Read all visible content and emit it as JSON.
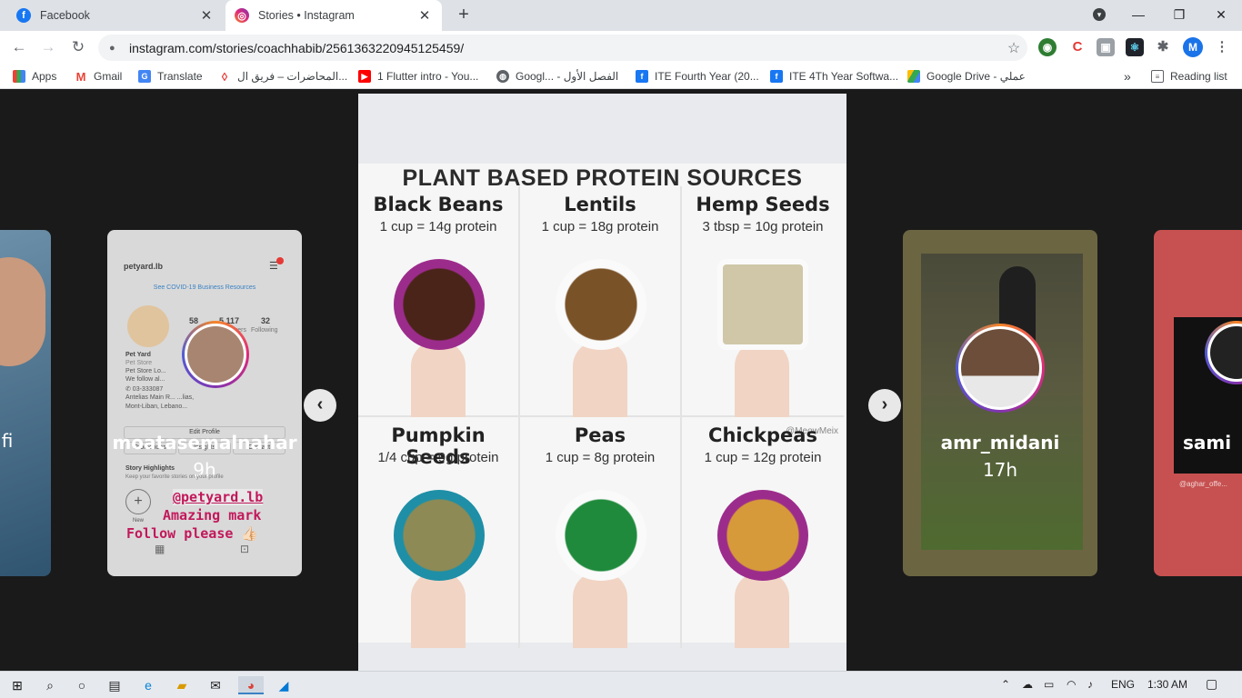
{
  "tabs": [
    {
      "title": "Facebook",
      "icon": "facebook-icon",
      "close": "✕"
    },
    {
      "title": "Stories • Instagram",
      "icon": "instagram-icon",
      "close": "✕"
    }
  ],
  "new_tab": "+",
  "window": {
    "minimize": "—",
    "restore": "❐",
    "close": "✕",
    "menu": "▾"
  },
  "toolbar": {
    "back": "←",
    "forward": "→",
    "reload": "↻",
    "lock": "🔒",
    "url": "instagram.com/stories/coachhabib/2561363220945125459/",
    "star": "☆",
    "profile_initial": "M"
  },
  "extensions": [
    "globe-extension-icon",
    "c-extension-icon",
    "profile-extension-icon",
    "react-devtools-icon",
    "puzzle-icon"
  ],
  "bookmarks": [
    {
      "label": "Apps",
      "icon": "apps-grid-icon"
    },
    {
      "label": "Gmail",
      "icon": "gmail-icon"
    },
    {
      "label": "Translate",
      "icon": "translate-icon"
    },
    {
      "label": "المحاضرات – فريق ال...",
      "icon": "bookmark-red-icon"
    },
    {
      "label": "1 Flutter intro - You...",
      "icon": "youtube-icon"
    },
    {
      "label": "Googl... - الفصل الأول",
      "icon": "globe-icon"
    },
    {
      "label": "ITE Fourth Year (20...",
      "icon": "facebook-icon"
    },
    {
      "label": "ITE 4Th Year Softwa...",
      "icon": "facebook-icon"
    },
    {
      "label": "Google Drive - عملي",
      "icon": "google-drive-icon"
    }
  ],
  "bookmarks_overflow": "»",
  "reading_list": "Reading list",
  "stories": {
    "left_far": {
      "username_fragment": "fi"
    },
    "left": {
      "username": "moatasemalnahar",
      "time": "9h",
      "profile": {
        "handle": "petyard.lb",
        "covid": "See COVID-19 Business Resources",
        "posts": "58",
        "followers": "5,117",
        "following": "32",
        "followers_label": "Followers",
        "following_label": "Following",
        "name": "Pet Yard",
        "category": "Pet Store",
        "line1": "Pet Store Lo...",
        "line2": "We follow al...",
        "line3": "✆ 03-333087",
        "line4": "Antelias Main R... ...lias,",
        "line5": "Mont-Liban, Lebano...",
        "edit_profile": "Edit Profile",
        "promotions": "Promotions",
        "insights": "Insights",
        "contact": "Contact",
        "highlights": "Story Highlights",
        "highlights_sub": "Keep your favorite stories on your profile",
        "new": "New"
      },
      "sticker": [
        "@petyard.lb",
        "Amazing mark",
        "Follow please 👍🏻"
      ]
    },
    "main": {
      "poster_title": "PLANT BASED PROTEIN SOURCES",
      "watermark": "@MeowMeix",
      "items": [
        {
          "name": "Black Beans",
          "amount": "1 cup = 14g protein",
          "color": "#4a2418"
        },
        {
          "name": "Lentils",
          "amount": "1 cup = 18g protein",
          "color": "#7a5228"
        },
        {
          "name": "Hemp Seeds",
          "amount": "3 tbsp = 10g protein",
          "color": "#cfc7a8"
        },
        {
          "name": "Pumpkin Seeds",
          "amount": "1/4 cup = 9g protein",
          "color": "#8d8a55"
        },
        {
          "name": "Peas",
          "amount": "1 cup = 8g protein",
          "color": "#1f8a3c"
        },
        {
          "name": "Chickpeas",
          "amount": "1 cup = 12g protein",
          "color": "#d79a3a"
        }
      ]
    },
    "prev_arrow": "‹",
    "next_arrow": "›",
    "right": {
      "username": "amr_midani",
      "time": "17h"
    },
    "right_far": {
      "username_fragment": "sami",
      "tag": "@aghar_offe..."
    }
  },
  "taskbar": {
    "language": "ENG",
    "time": "1:30 AM"
  }
}
